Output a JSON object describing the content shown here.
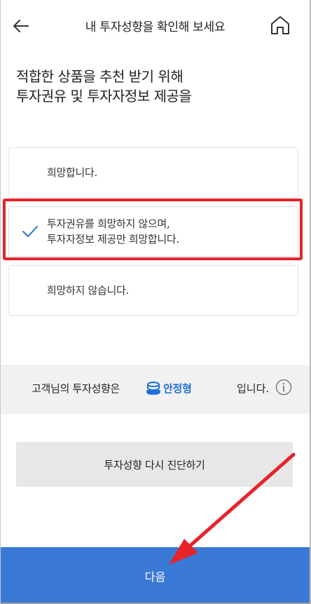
{
  "header": {
    "title": "내 투자성향을 확인해 보세요",
    "back_icon": "arrow-left-icon",
    "home_icon": "home-icon"
  },
  "heading": {
    "line1": "적합한 상품을 추천 받기 위해",
    "line2": "투자권유 및 투자자정보 제공을"
  },
  "options": [
    {
      "line1": "희망합니다.",
      "line2": "",
      "selected": false
    },
    {
      "line1": "투자권유를 희망하지 않으며,",
      "line2": "투자자정보 제공만 희망합니다.",
      "selected": true
    },
    {
      "line1": "희망하지 않습니다.",
      "line2": "",
      "selected": false
    }
  ],
  "result": {
    "prefix": "고객님의 투자성향은",
    "type": "안정형",
    "suffix": "입니다.",
    "type_color": "#1f6fd6",
    "type_icon": "stacked-coins-icon",
    "info_icon": "info-icon"
  },
  "buttons": {
    "retry_label": "투자성향 다시 진단하기",
    "next_label": "다음"
  },
  "colors": {
    "accent": "#3a7ad6",
    "highlight": "#e8232a",
    "check": "#2a6fd4"
  }
}
